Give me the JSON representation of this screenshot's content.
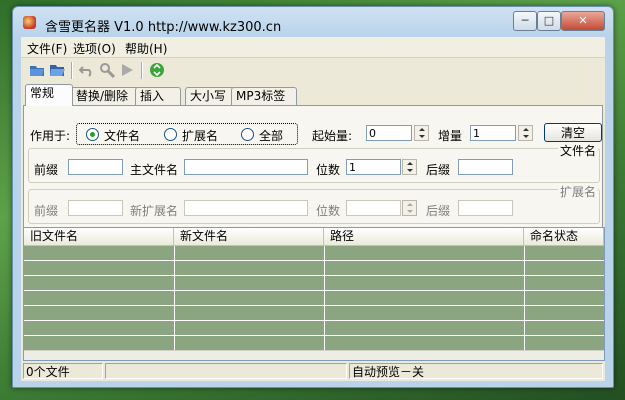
{
  "window": {
    "title": "含雪更名器 V1.0  http://www.kz300.cn",
    "min": "─",
    "max": "□",
    "close": "✕"
  },
  "menu": [
    "文件(F)",
    "选项(O)",
    "帮助(H)"
  ],
  "toolbar": {
    "icons": [
      "open-file-icon",
      "open-folder-icon",
      "undo-icon",
      "search-icon",
      "play-icon",
      "recycle-icon"
    ]
  },
  "tabs": [
    "常规",
    "替换/删除",
    "插入",
    "大小写",
    "MP3标签"
  ],
  "panel": {
    "apply_label": "作用于:",
    "radio": [
      "文件名",
      "扩展名",
      "全部"
    ],
    "start_label": "起始量:",
    "start_value": "0",
    "step_label": "增量",
    "step_value": "1",
    "clear": "清空",
    "file_group": "文件名",
    "prefix": "前缀",
    "main_name": "主文件名",
    "digits": "位数",
    "digits_value": "1",
    "suffix": "后缀",
    "ext_group": "扩展名",
    "prefix2": "前缀",
    "new_ext": "新扩展名",
    "digits2": "位数",
    "suffix2": "后缀"
  },
  "grid": {
    "columns": [
      "旧文件名",
      "新文件名",
      "路径",
      "命名状态"
    ]
  },
  "status": {
    "count": "0个文件",
    "preview": "自动预览－关"
  }
}
